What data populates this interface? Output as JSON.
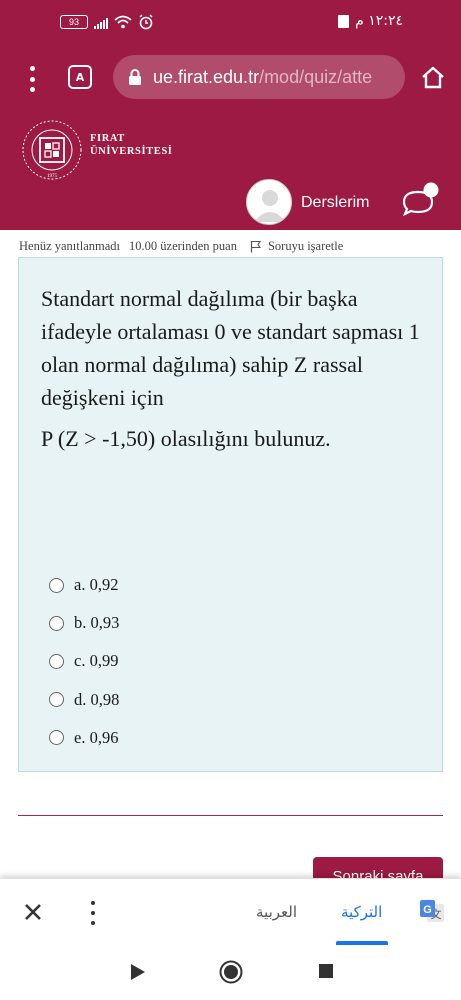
{
  "status_bar": {
    "battery": "93",
    "time": "١٢:٢٤ م",
    "colors": {
      "bar": "#9c1a44"
    }
  },
  "browser": {
    "url_host": "ue.firat.edu.tr",
    "url_path": "/mod/quiz/atte"
  },
  "site": {
    "brand_line1": "FIRAT",
    "brand_line2": "ÜNİVERSİTESİ",
    "logo_ring_text": "UNIVERSITESI · FIRAT",
    "logo_year": "1975",
    "user_menu_label": "Derslerim",
    "accent_color": "#9c1a44"
  },
  "question": {
    "status": "Henüz yanıtlanmadı",
    "points": "10.00 üzerinden puan",
    "flag_label": "Soruyu işaretle",
    "text": "Standart normal dağılıma (bir başka ifadeyle ortalaması 0 ve standart sapması 1 olan normal dağılıma) sahip Z rassal değişkeni için",
    "prompt": "P (Z > -1,50) olasılığını bulunuz.",
    "answers": [
      {
        "label": "a. 0,92"
      },
      {
        "label": "b. 0,93"
      },
      {
        "label": "c. 0,99"
      },
      {
        "label": "d. 0,98"
      },
      {
        "label": "e. 0,96"
      }
    ]
  },
  "navigation": {
    "next_label": "Sonraki sayfa"
  },
  "translate_bar": {
    "lang_source": "العربية",
    "lang_target": "التركية",
    "selected_color": "#1a73e8"
  }
}
